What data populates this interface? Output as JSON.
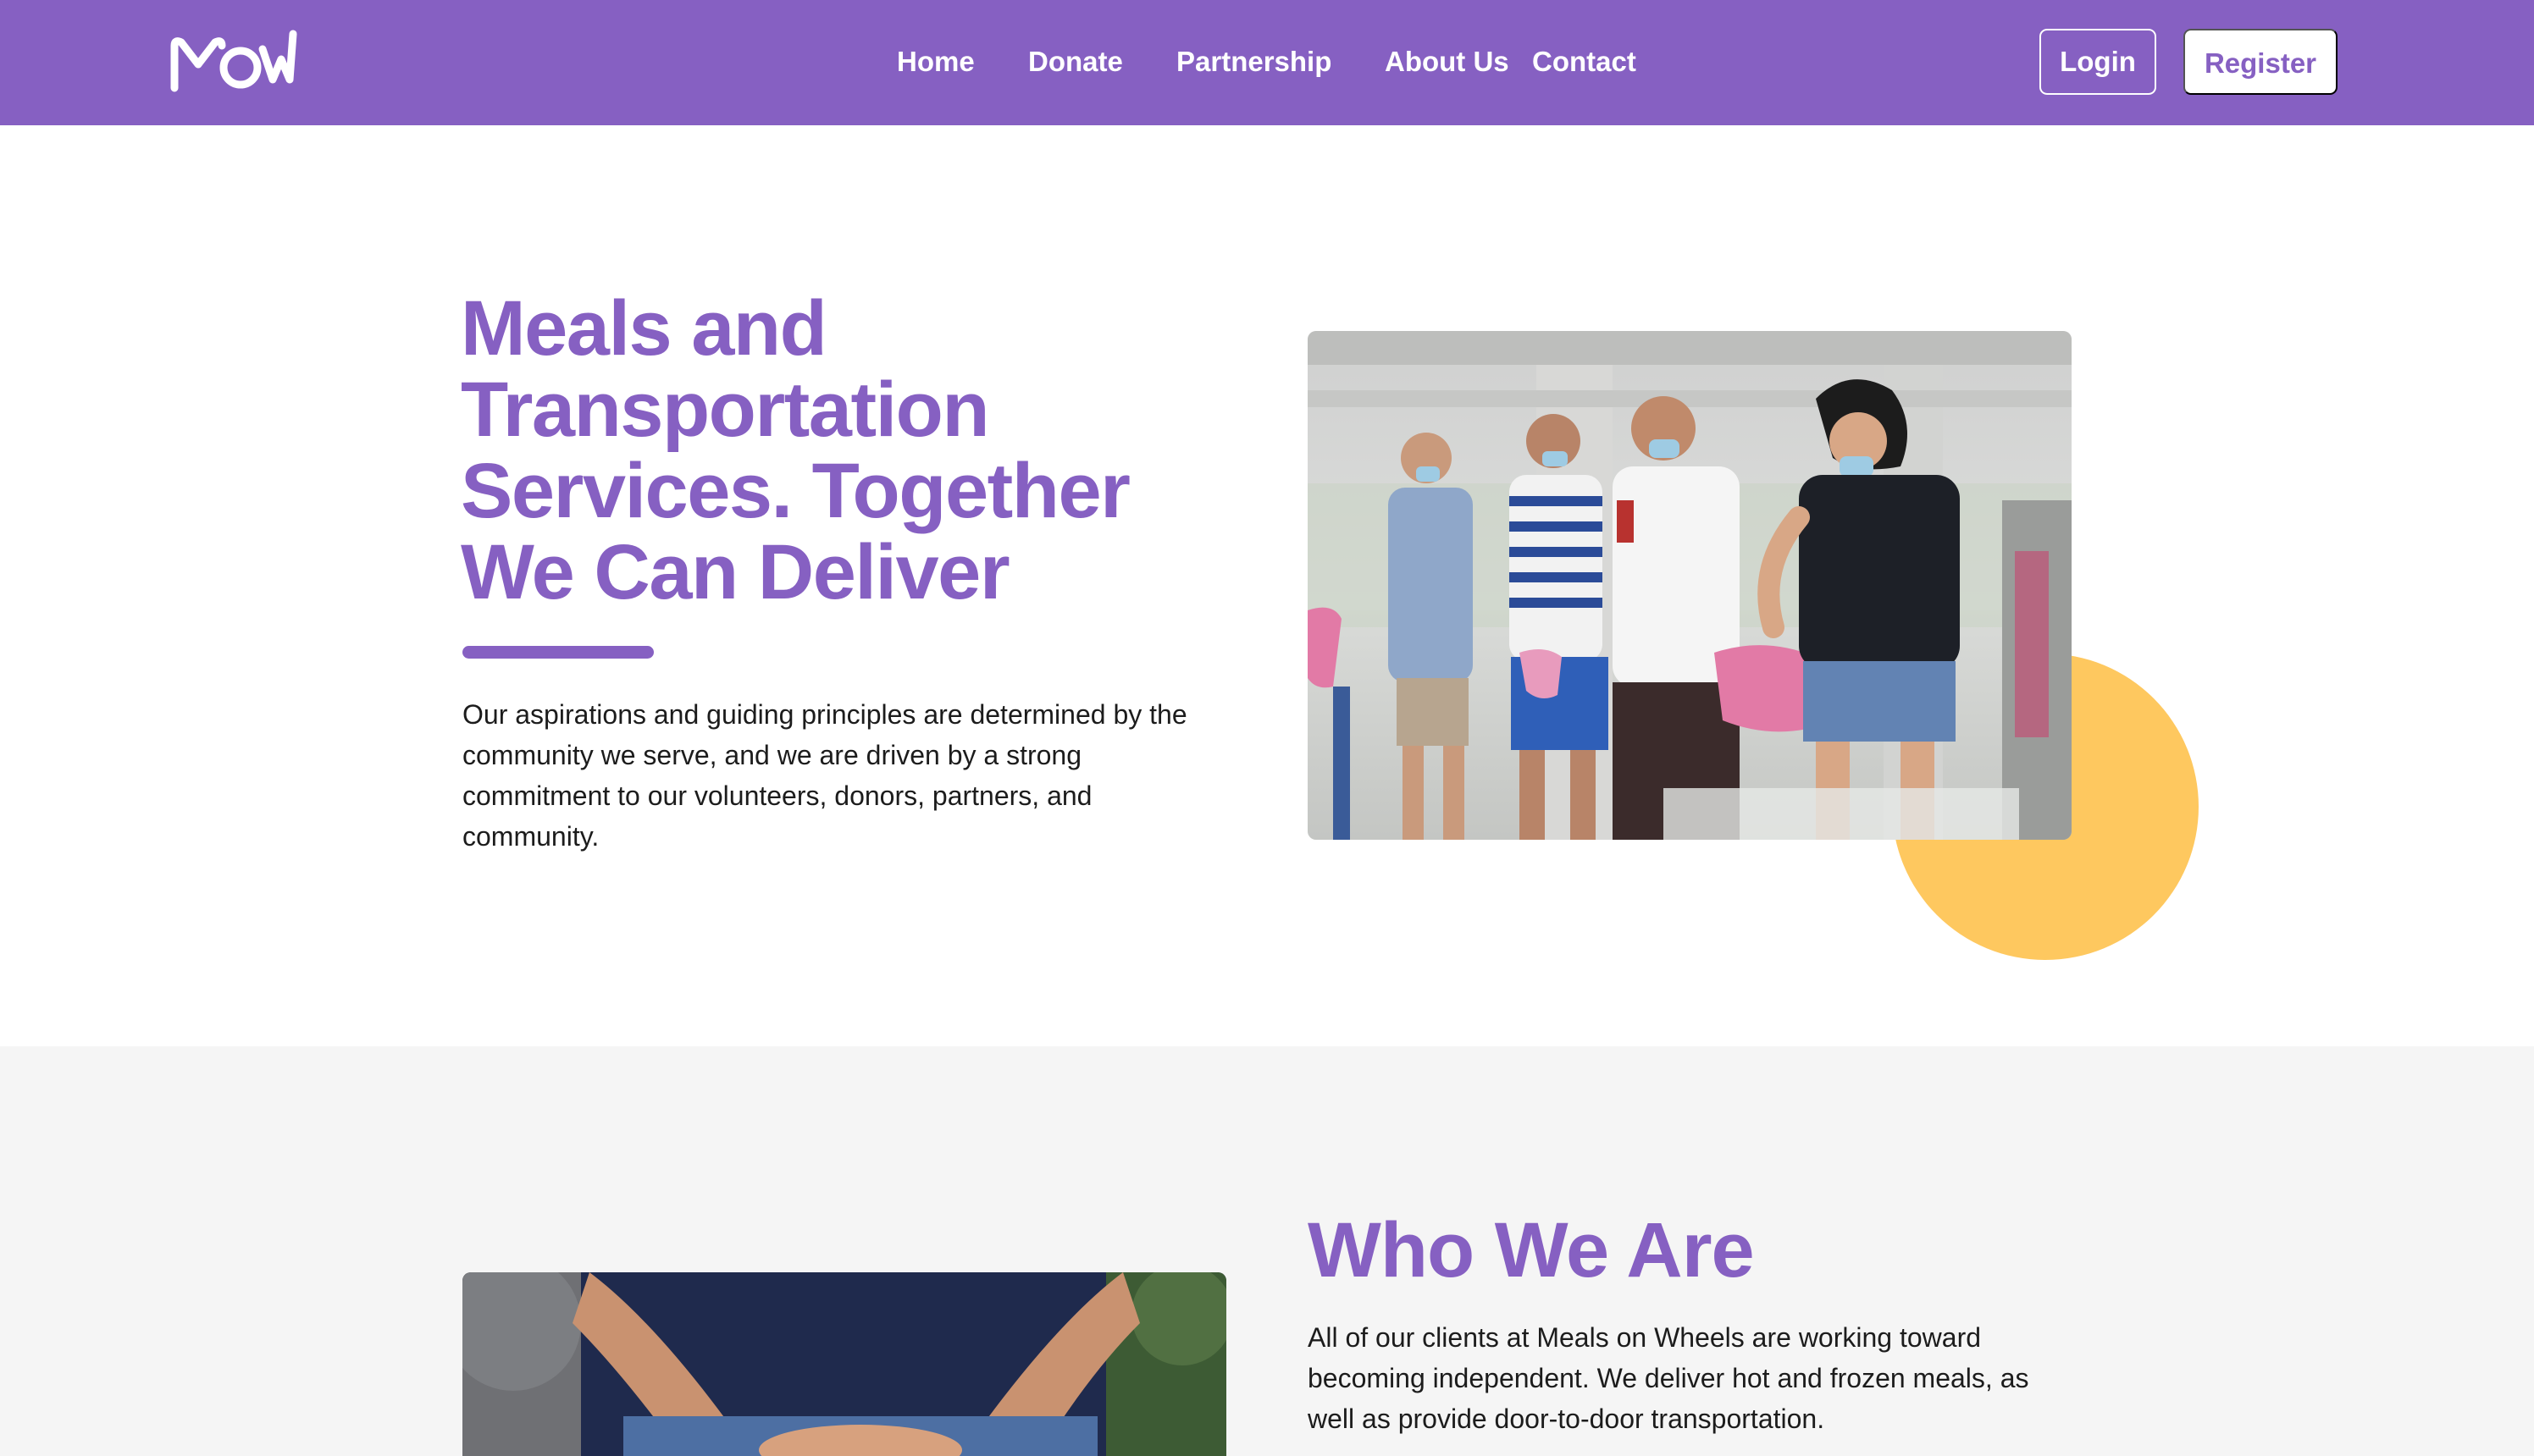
{
  "brand": {
    "logo_text": "MOW",
    "primary_color": "#8660c2",
    "accent_color": "#fec85f"
  },
  "nav": {
    "links": [
      {
        "label": "Home"
      },
      {
        "label": "Donate"
      },
      {
        "label": "Partnership"
      },
      {
        "label": "About Us"
      },
      {
        "label": "Contact"
      }
    ],
    "login_label": "Login",
    "register_label": "Register"
  },
  "hero": {
    "title_lines": [
      "Meals and",
      "Transportation",
      "Services. Together",
      "We Can Deliver"
    ],
    "paragraph_lines": [
      "Our aspirations and guiding principles are determined by the",
      "community we serve, and we are driven by a strong",
      "commitment to our volunteers, donors, partners, and",
      "community."
    ],
    "photo_alt": "volunteer-handing-food-to-elderly-men"
  },
  "about": {
    "title": "Who We Are",
    "paragraph_lines": [
      "All of our clients at Meals on Wheels are working toward",
      "becoming independent. We deliver hot and frozen meals, as",
      "well as provide door-to-door transportation."
    ],
    "photo_alt": "hands-holding-food"
  }
}
